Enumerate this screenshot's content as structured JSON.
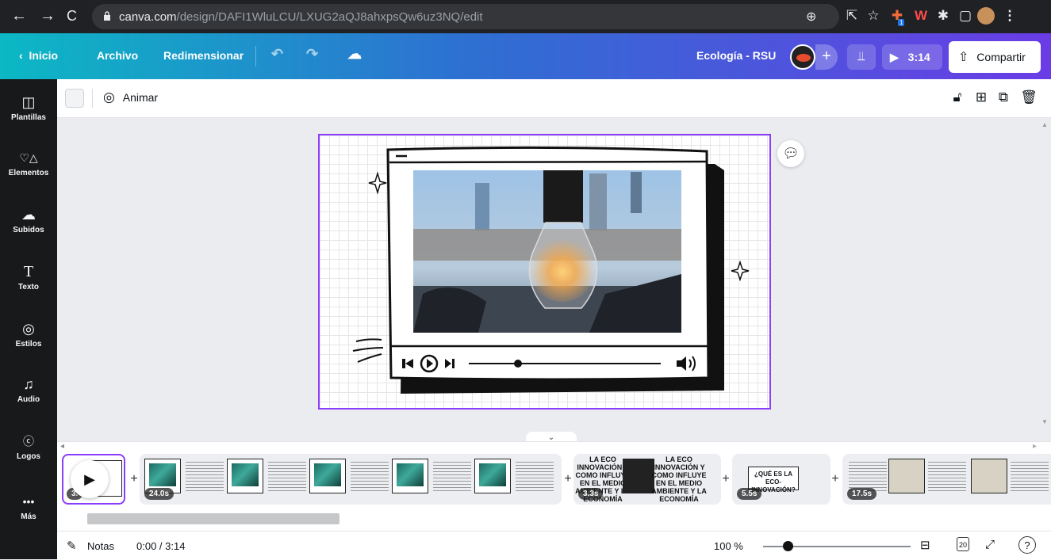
{
  "browser": {
    "url_domain": "canva.com",
    "url_path": "/design/DAFI1WluLCU/LXUG2aQJ8ahxpsQw6uz3NQ/edit",
    "extension_badge": "1"
  },
  "header": {
    "home": "Inicio",
    "file": "Archivo",
    "resize": "Redimensionar",
    "design_title": "Ecología - RSU",
    "present_time": "3:14",
    "share": "Compartir",
    "add_member": "+"
  },
  "sidebar": {
    "items": [
      {
        "label": "Plantillas",
        "icon": "templates-icon"
      },
      {
        "label": "Elementos",
        "icon": "elements-icon"
      },
      {
        "label": "Subidos",
        "icon": "upload-icon"
      },
      {
        "label": "Texto",
        "icon": "text-icon"
      },
      {
        "label": "Estilos",
        "icon": "palette-icon"
      },
      {
        "label": "Audio",
        "icon": "music-icon"
      },
      {
        "label": "Logos",
        "icon": "logos-icon"
      },
      {
        "label": "Más",
        "icon": "more-icon"
      }
    ]
  },
  "toolbar": {
    "animate": "Animar"
  },
  "timeline": {
    "clips": [
      {
        "duration": "3.",
        "selected": true
      },
      {
        "duration": "24.0s"
      },
      {
        "duration": "3.3s",
        "text": "LA ECO INNOVACIÓN Y COMO INFLUYE EN EL MEDIO AMBIENTE Y LA ECONOMÍA",
        "text2": "LA ECO INNOVACIÓN Y COMO INFLUYE EN EL MEDIO AMBIENTE Y LA ECONOMÍA"
      },
      {
        "duration": "5.5s",
        "text": "¿QUÉ ES LA ECO-INNOVACIÓN?"
      },
      {
        "duration": "17.5s"
      }
    ]
  },
  "bottom": {
    "notes": "Notas",
    "time": "0:00 / 3:14",
    "zoom": "100 %",
    "page_count": "20"
  },
  "colors": {
    "accent": "#8b3dff",
    "header_start": "#0cb8c4",
    "header_end": "#6a3ce6",
    "sidebar": "#18191b"
  }
}
